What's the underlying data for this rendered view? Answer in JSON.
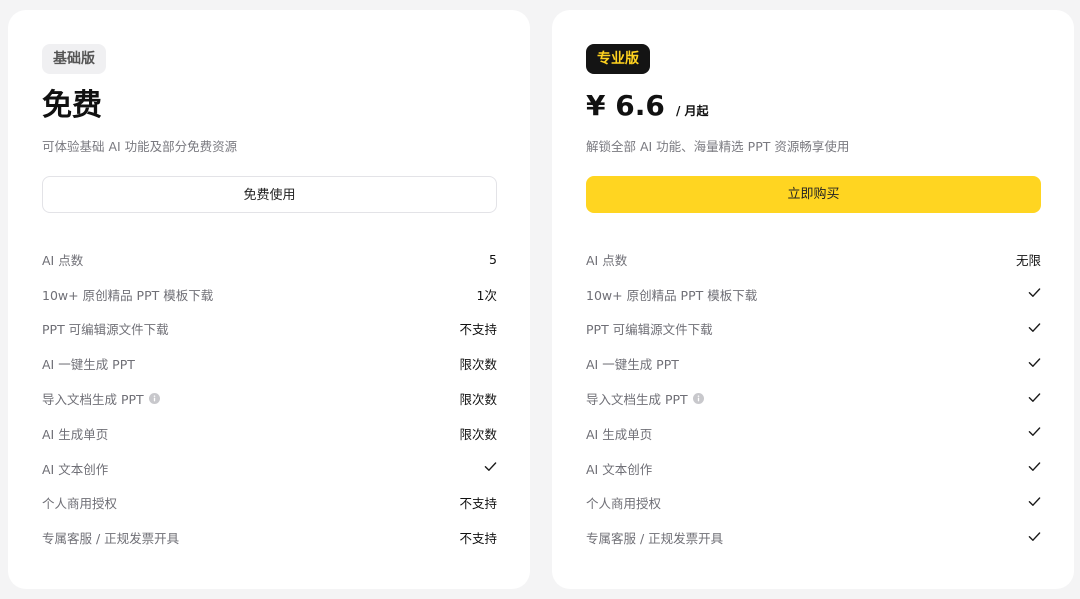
{
  "free_plan": {
    "badge": "基础版",
    "title": "免费",
    "description": "可体验基础 AI 功能及部分免费资源",
    "button_label": "免费使用",
    "features": [
      {
        "label": "AI 点数",
        "value": "5"
      },
      {
        "label": "10w+ 原创精品 PPT 模板下载",
        "value": "1次"
      },
      {
        "label": "PPT 可编辑源文件下载",
        "value": "不支持"
      },
      {
        "label": "AI 一键生成 PPT",
        "value": "限次数"
      },
      {
        "label": "导入文档生成 PPT",
        "value": "限次数",
        "info_icon": true
      },
      {
        "label": "AI 生成单页",
        "value": "限次数"
      },
      {
        "label": "AI 文本创作",
        "value": "",
        "check": true
      },
      {
        "label": "个人商用授权",
        "value": "不支持"
      },
      {
        "label": "专属客服 / 正规发票开具",
        "value": "不支持"
      }
    ]
  },
  "pro_plan": {
    "badge": "专业版",
    "price": "¥ 6.6",
    "price_unit": "/ 月起",
    "description": "解锁全部 AI 功能、海量精选 PPT 资源畅享使用",
    "button_label": "立即购买",
    "features": [
      {
        "label": "AI 点数",
        "value": "无限"
      },
      {
        "label": "10w+ 原创精品 PPT 模板下载",
        "value": "",
        "check": true
      },
      {
        "label": "PPT 可编辑源文件下载",
        "value": "",
        "check": true
      },
      {
        "label": "AI 一键生成 PPT",
        "value": "",
        "check": true
      },
      {
        "label": "导入文档生成 PPT",
        "value": "",
        "check": true,
        "info_icon": true
      },
      {
        "label": "AI 生成单页",
        "value": "",
        "check": true
      },
      {
        "label": "AI 文本创作",
        "value": "",
        "check": true
      },
      {
        "label": "个人商用授权",
        "value": "",
        "check": true
      },
      {
        "label": "专属客服 / 正规发票开具",
        "value": "",
        "check": true
      }
    ]
  },
  "colors": {
    "page_background": "#f4f4f5",
    "pro_accent": "#ffd521",
    "pro_badge_background": "#141414",
    "pro_badge_text": "#ffd21f"
  },
  "icons": {
    "check": "check-icon",
    "info": "info-icon"
  }
}
